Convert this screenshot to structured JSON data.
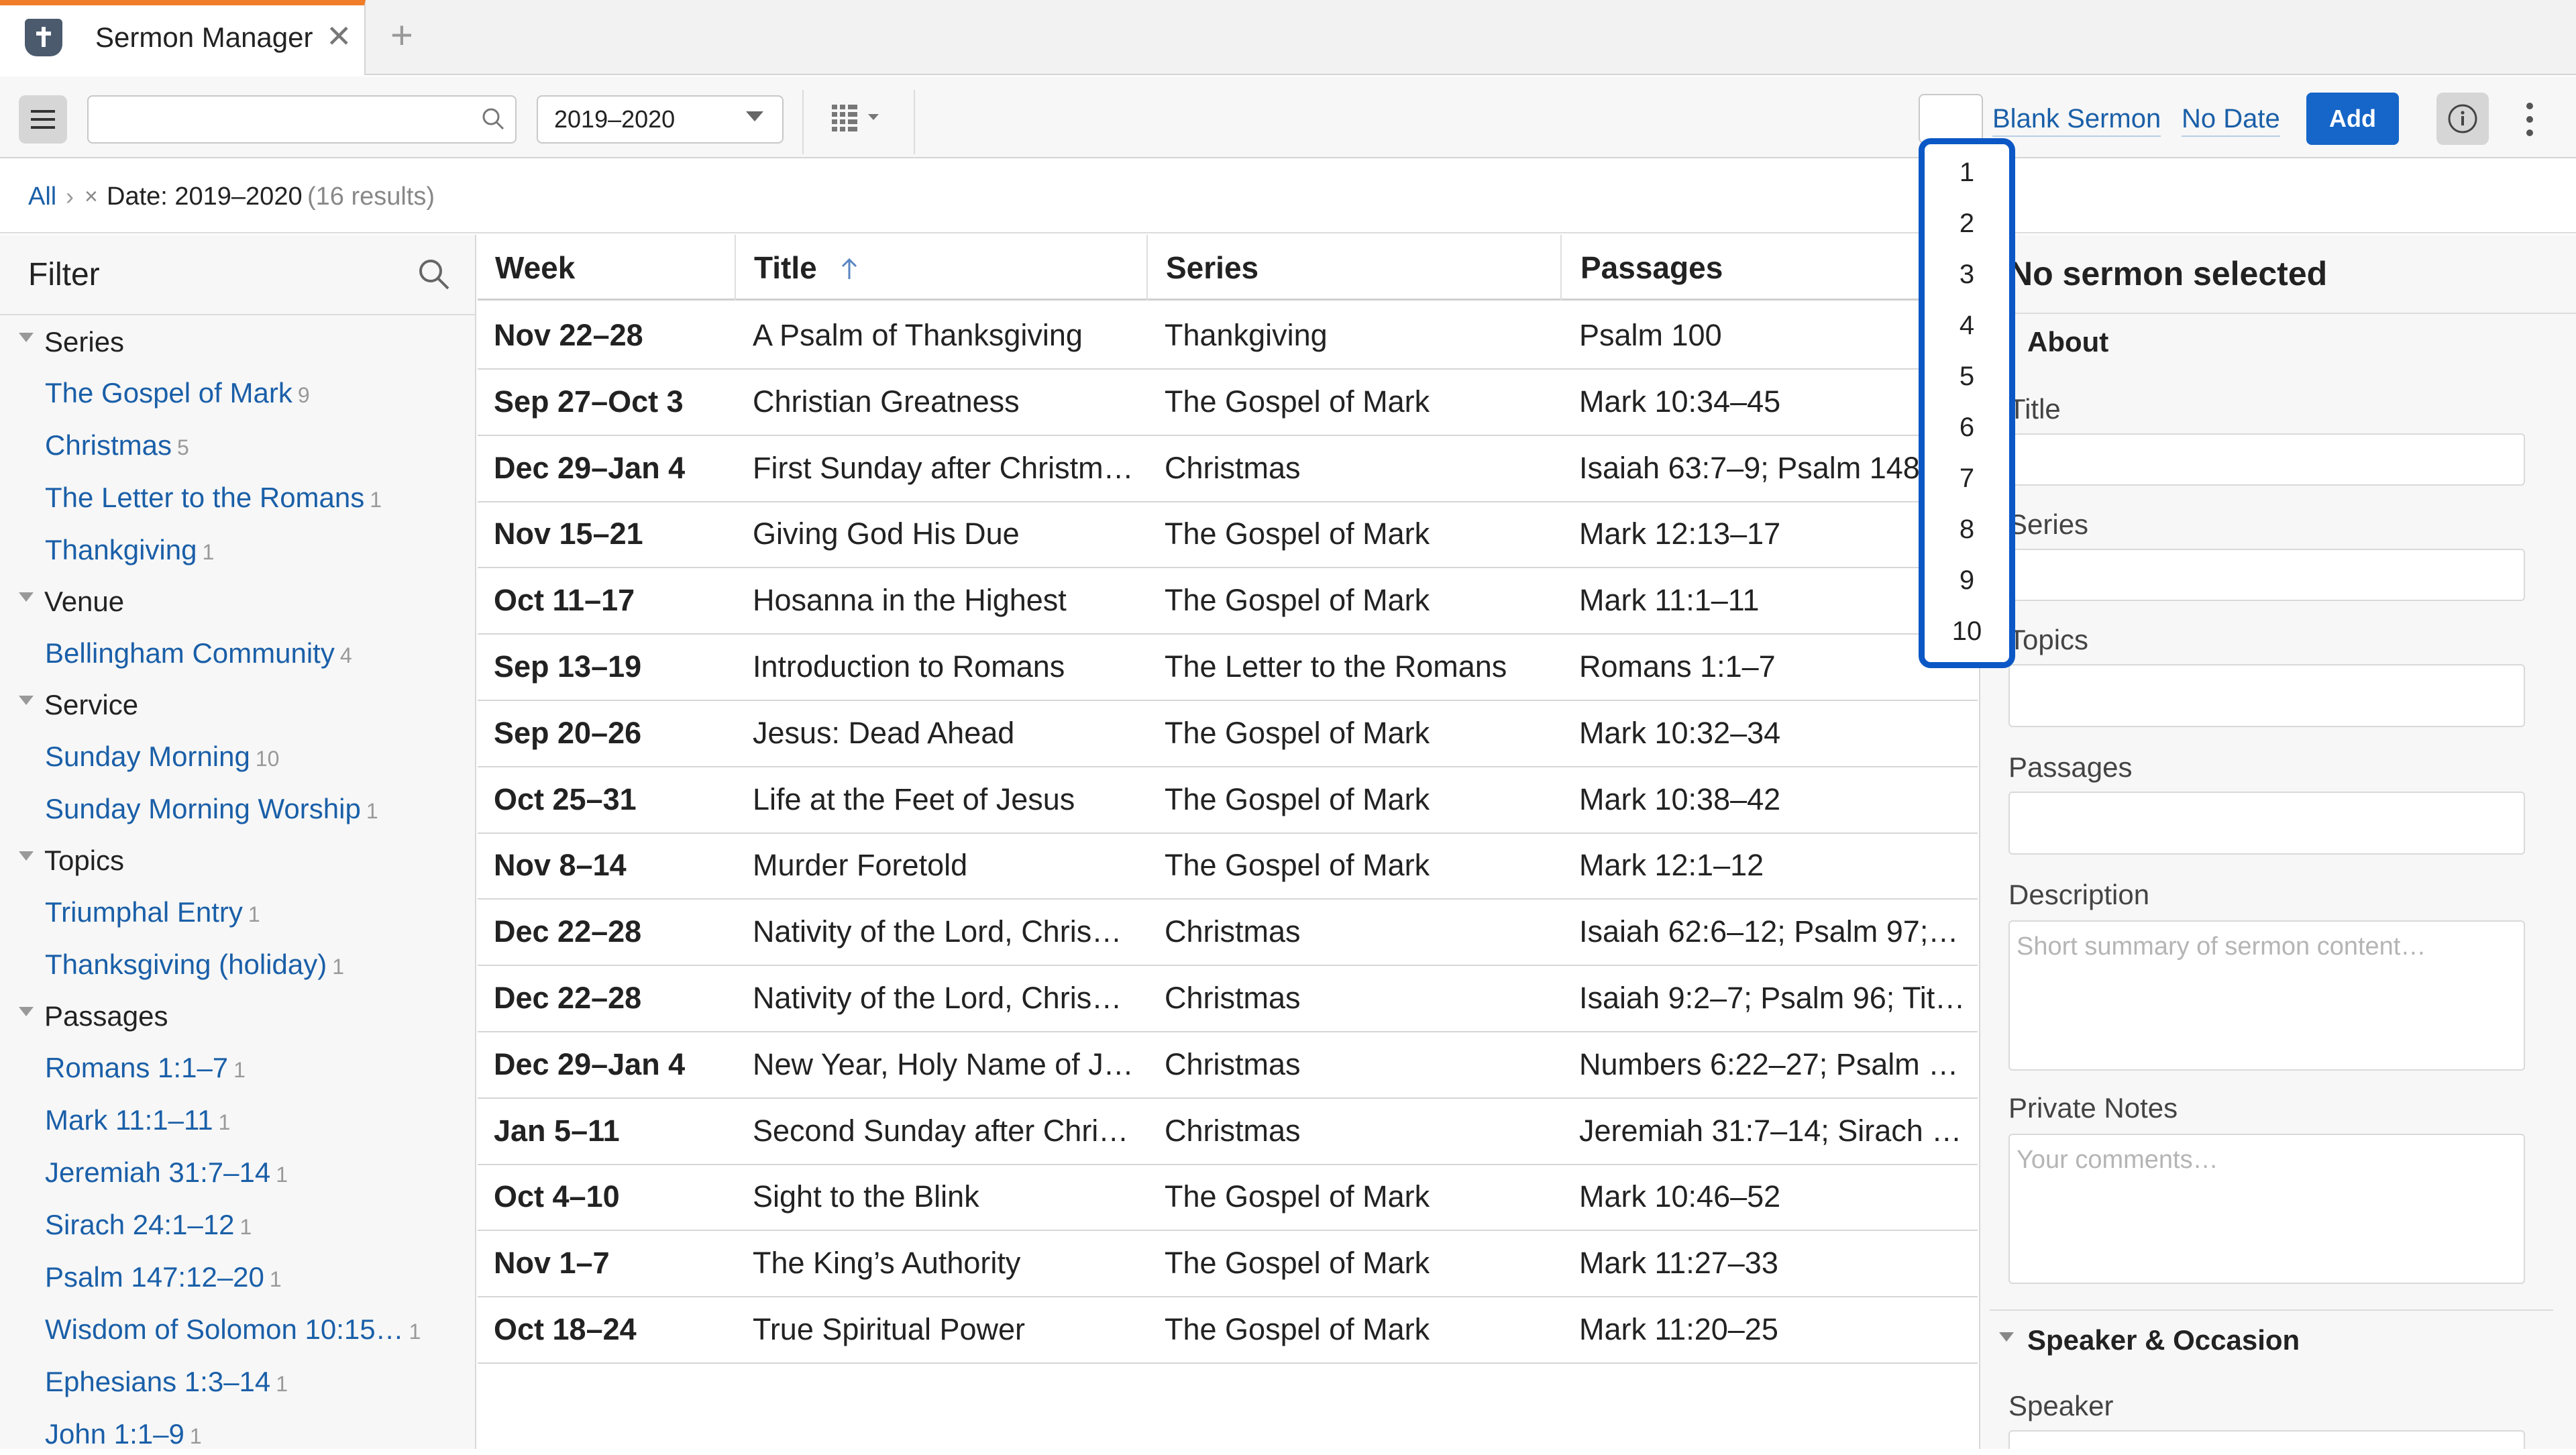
{
  "tab": {
    "title": "Sermon Manager",
    "close_glyph": "✕",
    "new_glyph": "+"
  },
  "toolbar": {
    "search_placeholder": "",
    "date_range": "2019–2020",
    "number_value": "",
    "blank_sermon_label": "Blank Sermon",
    "no_date_label": "No Date",
    "add_label": "Add"
  },
  "breadcrumb": {
    "root": "All",
    "separator": "›",
    "remove_glyph": "×",
    "filter": "Date: 2019–2020",
    "results": "(16 results)"
  },
  "filter": {
    "title": "Filter",
    "groups": [
      {
        "label": "Series",
        "items": [
          {
            "label": "The Gospel of Mark",
            "count": "9"
          },
          {
            "label": "Christmas",
            "count": "5"
          },
          {
            "label": "The Letter to the Romans",
            "count": "1"
          },
          {
            "label": "Thankgiving",
            "count": "1"
          }
        ]
      },
      {
        "label": "Venue",
        "items": [
          {
            "label": "Bellingham Community",
            "count": "4"
          }
        ]
      },
      {
        "label": "Service",
        "items": [
          {
            "label": "Sunday Morning",
            "count": "10"
          },
          {
            "label": "Sunday Morning Worship",
            "count": "1"
          }
        ]
      },
      {
        "label": "Topics",
        "items": [
          {
            "label": "Triumphal Entry",
            "count": "1"
          },
          {
            "label": "Thanksgiving (holiday)",
            "count": "1"
          }
        ]
      },
      {
        "label": "Passages",
        "items": [
          {
            "label": "Romans 1:1–7",
            "count": "1"
          },
          {
            "label": "Mark 11:1–11",
            "count": "1"
          },
          {
            "label": "Jeremiah 31:7–14",
            "count": "1"
          },
          {
            "label": "Sirach 24:1–12",
            "count": "1"
          },
          {
            "label": "Psalm 147:12–20",
            "count": "1"
          },
          {
            "label": "Wisdom of Solomon 10:15…",
            "count": "1"
          },
          {
            "label": "Ephesians 1:3–14",
            "count": "1"
          },
          {
            "label": "John 1:1–9",
            "count": "1"
          }
        ]
      }
    ]
  },
  "table": {
    "columns": [
      "Week",
      "Title",
      "Series",
      "Passages"
    ],
    "rows": [
      {
        "week": "Nov 22–28",
        "title": "A Psalm of Thanksgiving",
        "series": "Thankgiving",
        "passages": "Psalm 100"
      },
      {
        "week": "Sep 27–Oct 3",
        "title": "Christian Greatness",
        "series": "The Gospel of Mark",
        "passages": "Mark 10:34–45"
      },
      {
        "week": "Dec 29–Jan 4",
        "title": "First Sunday after Christm…",
        "series": "Christmas",
        "passages": "Isaiah 63:7–9; Psalm 148; …"
      },
      {
        "week": "Nov 15–21",
        "title": "Giving God His Due",
        "series": "The Gospel of Mark",
        "passages": "Mark 12:13–17"
      },
      {
        "week": "Oct 11–17",
        "title": "Hosanna in the Highest",
        "series": "The Gospel of Mark",
        "passages": "Mark 11:1–11"
      },
      {
        "week": "Sep 13–19",
        "title": "Introduction to Romans",
        "series": "The Letter to the Romans",
        "passages": "Romans 1:1–7"
      },
      {
        "week": "Sep 20–26",
        "title": "Jesus: Dead Ahead",
        "series": "The Gospel of Mark",
        "passages": "Mark 10:32–34"
      },
      {
        "week": "Oct 25–31",
        "title": "Life at the Feet of Jesus",
        "series": "The Gospel of Mark",
        "passages": "Mark 10:38–42"
      },
      {
        "week": "Nov 8–14",
        "title": "Murder Foretold",
        "series": "The Gospel of Mark",
        "passages": "Mark 12:1–12"
      },
      {
        "week": "Dec 22–28",
        "title": "Nativity of the Lord, Chris…",
        "series": "Christmas",
        "passages": "Isaiah 62:6–12; Psalm 97; …"
      },
      {
        "week": "Dec 22–28",
        "title": "Nativity of the Lord, Chris…",
        "series": "Christmas",
        "passages": "Isaiah 9:2–7; Psalm 96; Tit…"
      },
      {
        "week": "Dec 29–Jan 4",
        "title": "New Year, Holy Name of J…",
        "series": "Christmas",
        "passages": "Numbers 6:22–27; Psalm …"
      },
      {
        "week": "Jan 5–11",
        "title": "Second Sunday after Chri…",
        "series": "Christmas",
        "passages": "Jeremiah 31:7–14; Sirach …"
      },
      {
        "week": "Oct 4–10",
        "title": "Sight to the Blink",
        "series": "The Gospel of Mark",
        "passages": "Mark 10:46–52"
      },
      {
        "week": "Nov 1–7",
        "title": "The King’s Authority",
        "series": "The Gospel of Mark",
        "passages": "Mark 11:27–33"
      },
      {
        "week": "Oct 18–24",
        "title": "True Spiritual Power",
        "series": "The Gospel of Mark",
        "passages": "Mark 11:20–25"
      }
    ]
  },
  "detail": {
    "empty_title": "No sermon selected",
    "about_label": "About",
    "title_label": "Title",
    "series_label": "Series",
    "topics_label": "Topics",
    "passages_label": "Passages",
    "description_label": "Description",
    "description_placeholder": "Short summary of sermon content…",
    "notes_label": "Private Notes",
    "notes_placeholder": "Your comments…",
    "speaker_section_label": "Speaker & Occasion",
    "speaker_label": "Speaker"
  },
  "number_dropdown": {
    "options": [
      "1",
      "2",
      "3",
      "4",
      "5",
      "6",
      "7",
      "8",
      "9",
      "10"
    ]
  },
  "colors": {
    "accent": "#f07d2a",
    "link": "#1a5fa8",
    "primary_button": "#1566c8",
    "dropdown_highlight": "#0b57c6"
  }
}
